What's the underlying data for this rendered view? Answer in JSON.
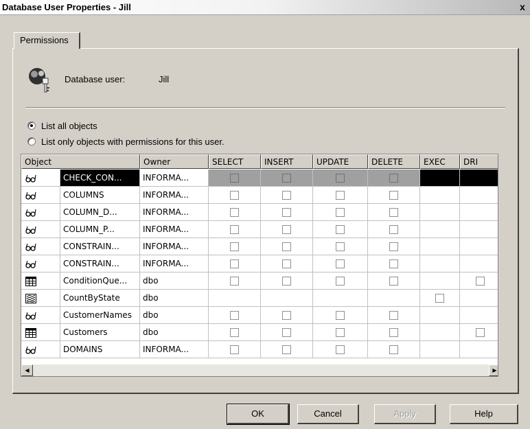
{
  "window": {
    "title": "Database User Properties - Jill",
    "close_label": "x"
  },
  "tabs": [
    {
      "label": "Permissions"
    }
  ],
  "user": {
    "label": "Database user:",
    "value": "Jill"
  },
  "radios": [
    {
      "label": "List all objects",
      "checked": true
    },
    {
      "label": "List only objects with permissions for this user.",
      "checked": false
    }
  ],
  "columns": [
    "Object",
    "Owner",
    "SELECT",
    "INSERT",
    "UPDATE",
    "DELETE",
    "EXEC",
    "DRI"
  ],
  "rows": [
    {
      "icon": "view-icon",
      "object": "CHECK_CON...",
      "owner": "INFORMA...",
      "boxes": [
        true,
        true,
        true,
        true,
        false,
        false
      ],
      "selected": true
    },
    {
      "icon": "view-icon",
      "object": "COLUMNS",
      "owner": "INFORMA...",
      "boxes": [
        true,
        true,
        true,
        true,
        false,
        false
      ]
    },
    {
      "icon": "view-icon",
      "object": "COLUMN_D...",
      "owner": "INFORMA...",
      "boxes": [
        true,
        true,
        true,
        true,
        false,
        false
      ]
    },
    {
      "icon": "view-icon",
      "object": "COLUMN_P...",
      "owner": "INFORMA...",
      "boxes": [
        true,
        true,
        true,
        true,
        false,
        false
      ]
    },
    {
      "icon": "view-icon",
      "object": "CONSTRAIN...",
      "owner": "INFORMA...",
      "boxes": [
        true,
        true,
        true,
        true,
        false,
        false
      ]
    },
    {
      "icon": "view-icon",
      "object": "CONSTRAIN...",
      "owner": "INFORMA...",
      "boxes": [
        true,
        true,
        true,
        true,
        false,
        false
      ]
    },
    {
      "icon": "table-icon",
      "object": "ConditionQue...",
      "owner": "dbo",
      "boxes": [
        true,
        true,
        true,
        true,
        false,
        true
      ]
    },
    {
      "icon": "stored-procedure-icon",
      "object": "CountByState",
      "owner": "dbo",
      "boxes": [
        false,
        false,
        false,
        false,
        true,
        false
      ]
    },
    {
      "icon": "view-icon",
      "object": "CustomerNames",
      "owner": "dbo",
      "boxes": [
        true,
        true,
        true,
        true,
        false,
        false
      ]
    },
    {
      "icon": "table-icon",
      "object": "Customers",
      "owner": "dbo",
      "boxes": [
        true,
        true,
        true,
        true,
        false,
        true
      ]
    },
    {
      "icon": "view-icon",
      "object": "DOMAINS",
      "owner": "INFORMA...",
      "boxes": [
        true,
        true,
        true,
        true,
        false,
        false
      ]
    }
  ],
  "buttons": {
    "ok": "OK",
    "cancel": "Cancel",
    "apply": "Apply",
    "help": "Help"
  }
}
